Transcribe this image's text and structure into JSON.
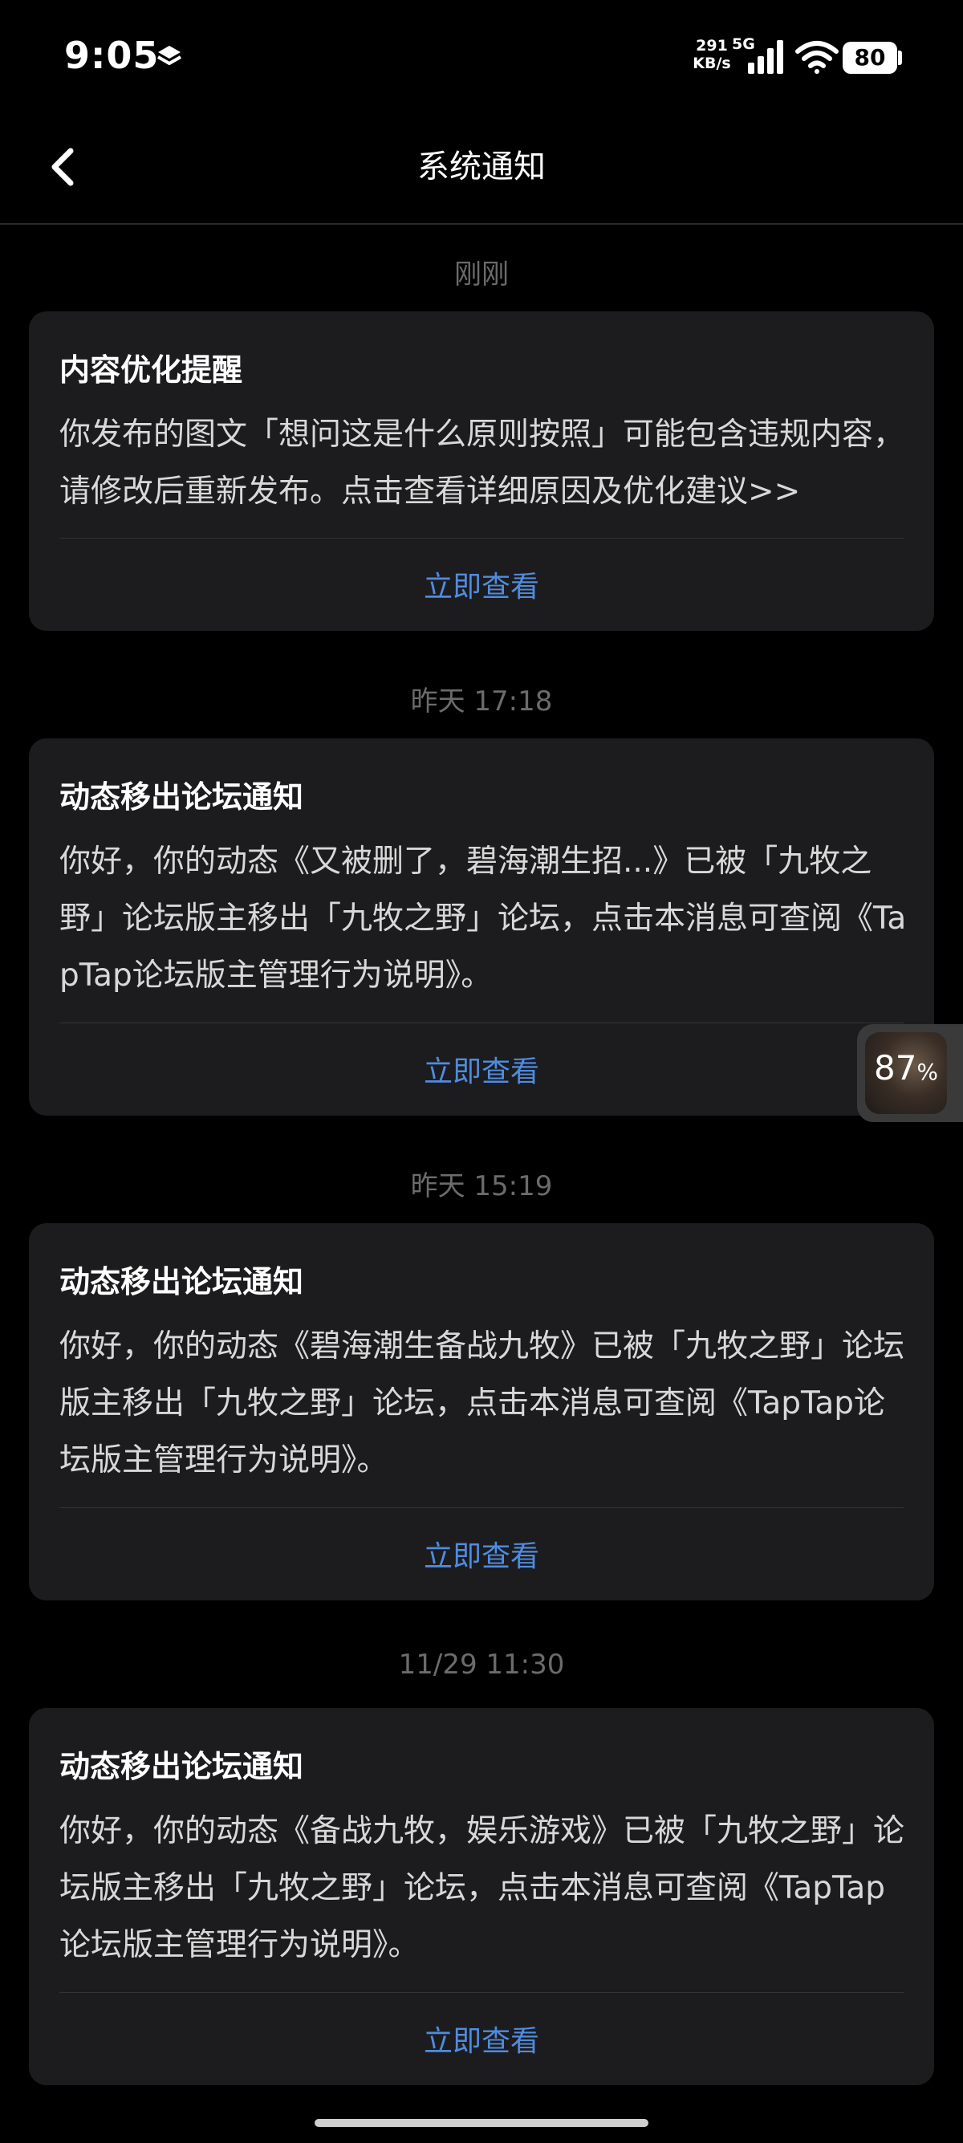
{
  "status_bar": {
    "time": "9:05",
    "net_speed_value": "291",
    "net_speed_unit": "KB/s",
    "network": "5G",
    "battery": "80",
    "icons": [
      "layers-icon",
      "signal-icon",
      "wifi-icon",
      "battery-icon"
    ]
  },
  "header": {
    "title": "系统通知",
    "back_icon": "chevron-left-icon"
  },
  "notifications": [
    {
      "time": "刚刚",
      "title": "内容优化提醒",
      "body": "你发布的图文「想问这是什么原则按照」可能包含违规内容，请修改后重新发布。点击查看详细原因及优化建议>>",
      "action": "立即查看"
    },
    {
      "time": "昨天  17:18",
      "title": "动态移出论坛通知",
      "body": "你好，你的动态《又被删了，碧海潮生招...》已被「九牧之野」论坛版主移出「九牧之野」论坛，点击本消息可查阅《TapTap论坛版主管理行为说明》。",
      "action": "立即查看"
    },
    {
      "time": "昨天  15:19",
      "title": "动态移出论坛通知",
      "body": "你好，你的动态《碧海潮生备战九牧》已被「九牧之野」论坛版主移出「九牧之野」论坛，点击本消息可查阅《TapTap论坛版主管理行为说明》。",
      "action": "立即查看"
    },
    {
      "time": "11/29  11:30",
      "title": "动态移出论坛通知",
      "body": "你好，你的动态《备战九牧，娱乐游戏》已被「九牧之野」论坛版主移出「九牧之野」论坛，点击本消息可查阅《TapTap论坛版主管理行为说明》。",
      "action": "立即查看"
    }
  ],
  "float_widget": {
    "value": "87",
    "unit": "%"
  },
  "colors": {
    "background": "#000000",
    "card": "#1c1c1e",
    "accent": "#4f8ce0",
    "timestamp": "#6b6b6b"
  }
}
